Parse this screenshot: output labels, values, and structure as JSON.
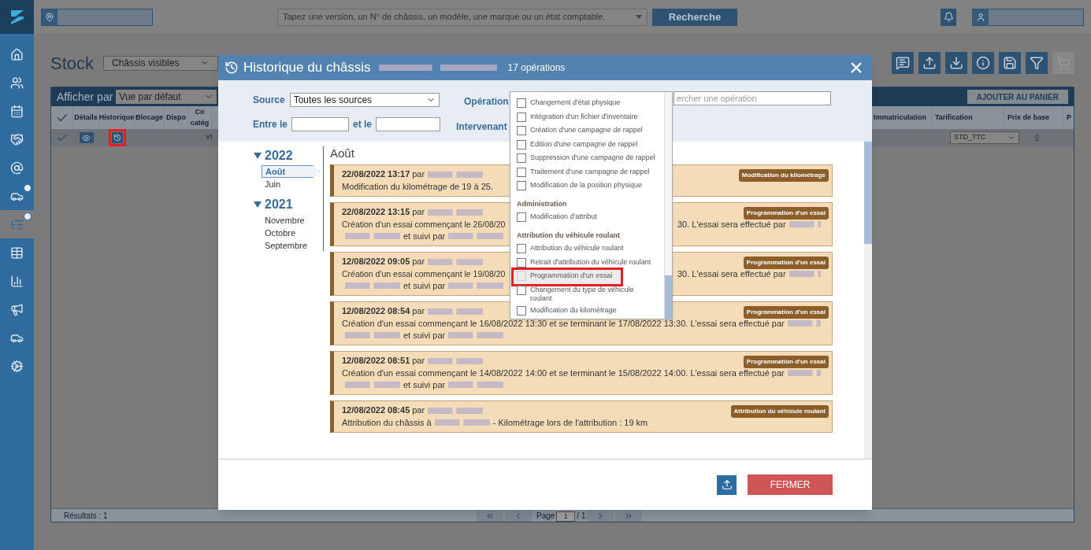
{
  "top_bar": {
    "search_placeholder": "Tapez une version, un N° de châssis, un modèle, une marque ou un état comptable.",
    "search_button": "Recherche"
  },
  "sidebar": {
    "items": [
      {
        "kind": "home",
        "selected": false,
        "badge": false
      },
      {
        "kind": "people",
        "selected": false,
        "badge": false
      },
      {
        "kind": "calendar",
        "selected": false,
        "badge": false
      },
      {
        "kind": "handshake",
        "selected": false,
        "badge": false
      },
      {
        "kind": "at",
        "selected": false,
        "badge": false
      },
      {
        "kind": "car",
        "selected": false,
        "badge": true
      },
      {
        "kind": "list",
        "selected": true,
        "badge": true
      },
      {
        "kind": "table",
        "selected": false,
        "badge": false
      },
      {
        "kind": "chart",
        "selected": false,
        "badge": false
      },
      {
        "kind": "megaphone",
        "selected": false,
        "badge": false
      },
      {
        "kind": "car",
        "selected": false,
        "badge": false
      },
      {
        "kind": "gears",
        "selected": false,
        "badge": false
      }
    ]
  },
  "page": {
    "title": "Stock",
    "view_select": "Châssis visibles",
    "toolbar": [
      {
        "kind": "chat",
        "disabled": false
      },
      {
        "kind": "upload",
        "disabled": false
      },
      {
        "kind": "download",
        "disabled": false
      },
      {
        "kind": "info",
        "disabled": false
      },
      {
        "kind": "save",
        "disabled": false
      },
      {
        "kind": "filter",
        "disabled": false
      },
      {
        "kind": "cart",
        "disabled": true
      }
    ],
    "display_by_label": "Afficher par",
    "display_by_select": "Vue par défaut",
    "add_to_cart": "AJOUTER AU PANIER",
    "columns_left": [
      "Détails",
      "Historique",
      "Blocage",
      "Dispo",
      "Co\ncatég"
    ],
    "columns_right": [
      "Immatriculation",
      "Tarification",
      "Prix de base",
      "P"
    ],
    "row": {
      "checked": true,
      "history_annotated": true,
      "cell_left": "VI",
      "tarification": "STD_TTC",
      "price": "0"
    },
    "results": "Résultats : 1",
    "pagination": {
      "label": "Page",
      "page": "1",
      "total": "/ 1"
    }
  },
  "modal": {
    "title": "Historique du châssis",
    "count": "17 opérations",
    "close": "×",
    "filters": {
      "source_label": "Source",
      "source_value": "Toutes les sources",
      "operation_label": "Opération",
      "operation_placeholder": "ercher une opération",
      "intervenant_label": "Intervenant",
      "between_label": "Entre le",
      "and_label": "et le"
    },
    "operation_dropdown": [
      {
        "kind": "item",
        "label": "Changement d'état physique",
        "checked": false,
        "highlighted": false,
        "annotated": false
      },
      {
        "kind": "item",
        "label": "Intégration d'un fichier d'inventaire",
        "checked": false,
        "highlighted": false,
        "annotated": false
      },
      {
        "kind": "item",
        "label": "Création d'une campagne de rappel",
        "checked": false,
        "highlighted": false,
        "annotated": false
      },
      {
        "kind": "item",
        "label": "Edition d'une campagne de rappel",
        "checked": false,
        "highlighted": false,
        "annotated": false
      },
      {
        "kind": "item",
        "label": "Suppression d'une campagne de rappel",
        "checked": false,
        "highlighted": false,
        "annotated": false
      },
      {
        "kind": "item",
        "label": "Traitement d'une campagne de rappel",
        "checked": false,
        "highlighted": false,
        "annotated": false
      },
      {
        "kind": "item",
        "label": "Modification de la position physique",
        "checked": false,
        "highlighted": false,
        "annotated": false
      },
      {
        "kind": "group",
        "label": "Administration"
      },
      {
        "kind": "item",
        "label": "Modification d'attribut",
        "checked": false,
        "highlighted": false,
        "annotated": false
      },
      {
        "kind": "group",
        "label": "Attribution du véhicule roulant"
      },
      {
        "kind": "item",
        "label": "Attribution du véhicule roulant",
        "checked": false,
        "highlighted": false,
        "annotated": false
      },
      {
        "kind": "item",
        "label": "Retrait d'attribution du véhicule roulant",
        "checked": false,
        "highlighted": false,
        "annotated": false
      },
      {
        "kind": "item",
        "label": "Programmation d'un essai",
        "checked": false,
        "highlighted": true,
        "annotated": true
      },
      {
        "kind": "item",
        "label": "Changement du type de véhicule roulant",
        "checked": false,
        "highlighted": false,
        "annotated": false
      },
      {
        "kind": "item",
        "label": "Modification du kilomètrage",
        "checked": false,
        "highlighted": false,
        "annotated": false
      }
    ],
    "timeline": [
      {
        "year": "2022",
        "expanded": true,
        "months": [
          {
            "label": "Août",
            "selected": true
          },
          {
            "label": "Juin",
            "selected": false
          }
        ]
      },
      {
        "year": "2021",
        "expanded": true,
        "months": [
          {
            "label": "Novembre",
            "selected": false
          },
          {
            "label": "Octobre",
            "selected": false
          },
          {
            "label": "Septembre",
            "selected": false
          }
        ]
      }
    ],
    "month_heading": "Août",
    "entries": [
      {
        "date": "22/08/2022 13:17",
        "by": "par",
        "tag": "Modification du kilométrage",
        "lines": [
          [
            {
              "kind": "text",
              "text": "Modification du kilométrage de 19 à 25."
            }
          ]
        ]
      },
      {
        "date": "22/08/2022 13:15",
        "by": "par",
        "tag": "Programmation d'un essai",
        "lines": [
          [
            {
              "kind": "text",
              "text": "Création d'un essai commençant le 26/08/20"
            },
            {
              "kind": "gap"
            },
            {
              "kind": "text",
              "text": "30. L'essai sera effectué par"
            },
            {
              "kind": "blur"
            }
          ],
          [
            {
              "kind": "blur"
            },
            {
              "kind": "text",
              "text": "et suivi par"
            },
            {
              "kind": "blur"
            }
          ]
        ]
      },
      {
        "date": "12/08/2022 09:05",
        "by": "par",
        "tag": "Programmation d'un essai",
        "lines": [
          [
            {
              "kind": "text",
              "text": "Création d'un essai commençant le 19/08/20"
            },
            {
              "kind": "gap"
            },
            {
              "kind": "text",
              "text": "30. L'essai sera effectué par"
            },
            {
              "kind": "blur"
            }
          ],
          [
            {
              "kind": "blur"
            },
            {
              "kind": "text",
              "text": "et suivi par"
            },
            {
              "kind": "blur"
            }
          ]
        ]
      },
      {
        "date": "12/08/2022 08:54",
        "by": "par",
        "tag": "Programmation d'un essai",
        "lines": [
          [
            {
              "kind": "text",
              "text": "Création d'un essai commençant le 16/08/2022 13:30 et se terminant le 17/08/2022 13:30. L'essai sera effectué par"
            },
            {
              "kind": "blur"
            }
          ],
          [
            {
              "kind": "blur"
            },
            {
              "kind": "text",
              "text": "et suivi par"
            },
            {
              "kind": "blur"
            }
          ]
        ]
      },
      {
        "date": "12/08/2022 08:51",
        "by": "par",
        "tag": "Programmation d'un essai",
        "lines": [
          [
            {
              "kind": "text",
              "text": "Création d'un essai commençant le 14/08/2022 14:00 et se terminant le 15/08/2022 14:00. L'essai sera effectué par"
            },
            {
              "kind": "blur"
            }
          ],
          [
            {
              "kind": "blur"
            },
            {
              "kind": "text",
              "text": "et suivi par"
            },
            {
              "kind": "blur"
            }
          ]
        ]
      },
      {
        "date": "12/08/2022 08:45",
        "by": "par",
        "tag": "Attribution du véhicule roulant",
        "lines": [
          [
            {
              "kind": "text",
              "text": "Attribution du châssis à"
            },
            {
              "kind": "blur"
            },
            {
              "kind": "text",
              "text": "- Kilométrage lors de l'attribution : 19 km"
            }
          ]
        ]
      }
    ],
    "close_button": "FERMER"
  }
}
